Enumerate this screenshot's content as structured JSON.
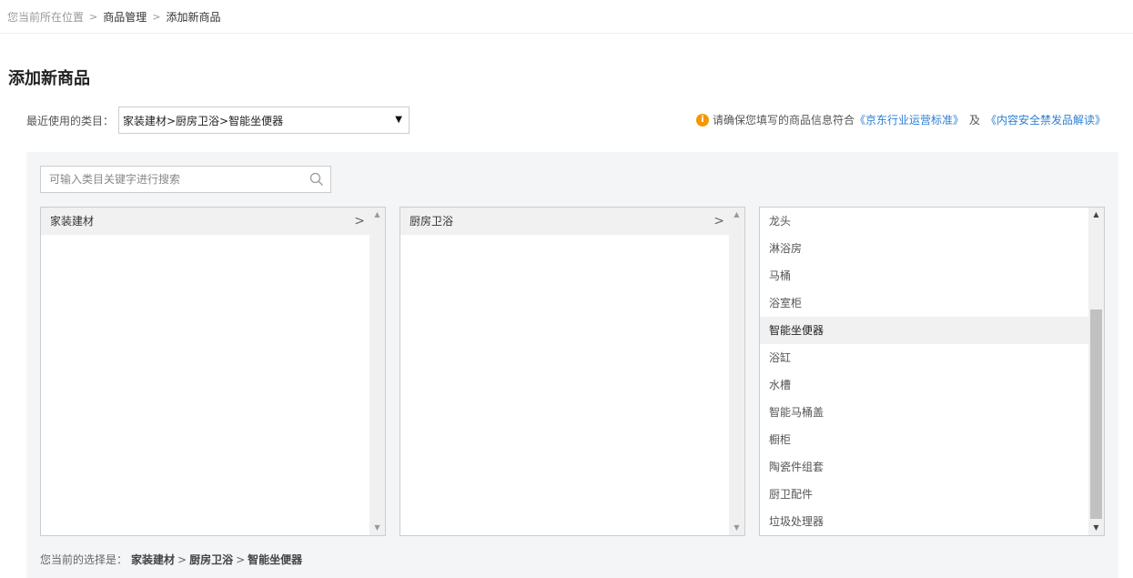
{
  "breadcrumb": {
    "prefix": "您当前所在位置",
    "items": [
      "商品管理",
      "添加新商品"
    ],
    "separator": ">"
  },
  "page_title": "添加新商品",
  "recent": {
    "label": "最近使用的类目：",
    "value": "家装建材>厨房卫浴>智能坐便器"
  },
  "notice": {
    "text": "请确保您填写的商品信息符合",
    "link1": "《京东行业运营标准》",
    "conjunction": "及",
    "link2": "《内容安全禁发品解读》"
  },
  "search": {
    "placeholder": "可输入类目关键字进行搜索"
  },
  "columns": {
    "level1": [
      {
        "label": "家装建材",
        "selected": true
      }
    ],
    "level2": [
      {
        "label": "厨房卫浴",
        "selected": true
      }
    ],
    "level3": [
      {
        "label": "龙头"
      },
      {
        "label": "淋浴房"
      },
      {
        "label": "马桶"
      },
      {
        "label": "浴室柜"
      },
      {
        "label": "智能坐便器",
        "selected": true
      },
      {
        "label": "浴缸"
      },
      {
        "label": "水槽"
      },
      {
        "label": "智能马桶盖"
      },
      {
        "label": "橱柜"
      },
      {
        "label": "陶瓷件组套"
      },
      {
        "label": "厨卫配件"
      },
      {
        "label": "垃圾处理器"
      }
    ]
  },
  "selection": {
    "label": "您当前的选择是：",
    "path": [
      "家装建材",
      "厨房卫浴",
      "智能坐便器"
    ]
  },
  "colors": {
    "link": "#2d7fd3",
    "info_icon": "#f39800",
    "panel_bg": "#f4f5f7"
  }
}
